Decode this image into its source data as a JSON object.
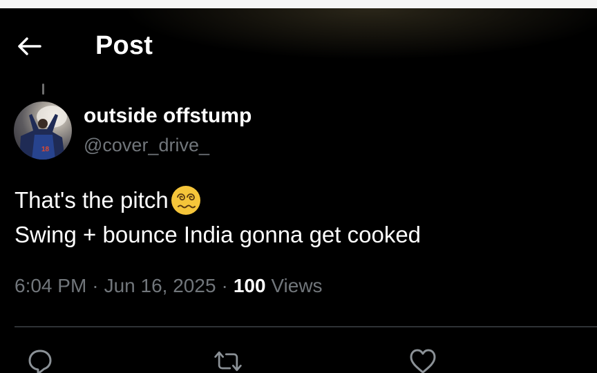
{
  "header": {
    "title": "Post",
    "back_icon": "arrow-left-icon"
  },
  "author": {
    "display_name": "outside offstump",
    "handle": "@cover_drive_",
    "avatar_icon": "avatar"
  },
  "post": {
    "line1": "That's the pitch",
    "emoji": "dizzy-face-emoji",
    "line2": "Swing + bounce India gonna get cooked"
  },
  "meta": {
    "time": "6:04 PM",
    "separator": "·",
    "date": "Jun 16, 2025",
    "views_count": "100",
    "views_label": "Views"
  },
  "actions": [
    {
      "icon": "reply-icon"
    },
    {
      "icon": "repost-icon"
    },
    {
      "icon": "like-icon"
    }
  ],
  "colors": {
    "background": "#000000",
    "primary_text": "#e7e9ea",
    "secondary_text": "#71767b",
    "divider": "#2f3336",
    "emoji": "#f5c53a"
  }
}
